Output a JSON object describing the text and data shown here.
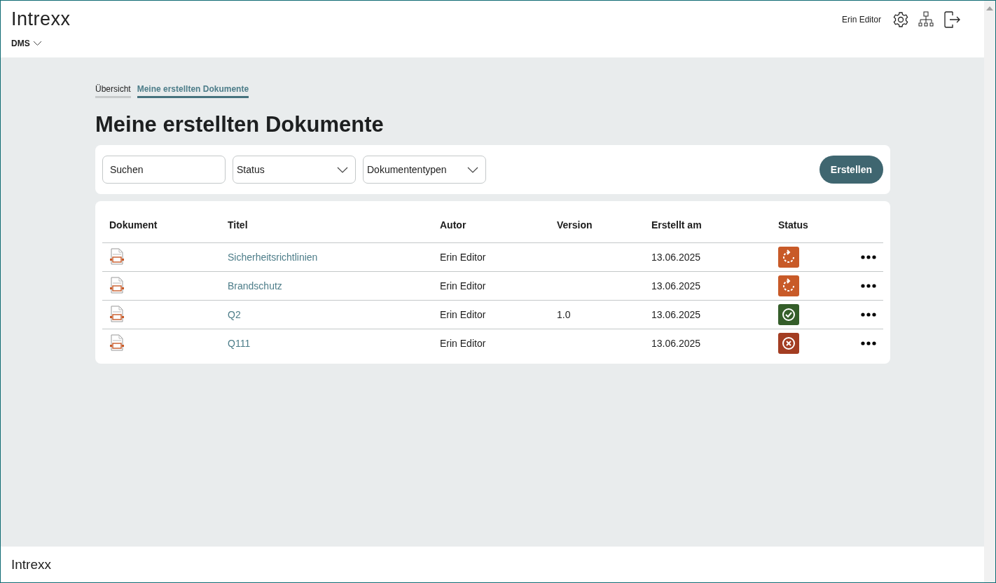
{
  "header": {
    "logo": "Intrexx",
    "app_menu": "DMS",
    "user": "Erin Editor"
  },
  "breadcrumbs": [
    {
      "label": "Übersicht",
      "selected": false
    },
    {
      "label": "Meine erstellten Dokumente",
      "selected": true
    }
  ],
  "page_title": "Meine erstellten Dokumente",
  "filters": {
    "search": {
      "placeholder": "Suchen"
    },
    "dropdowns": [
      "Status",
      "Dokumententypen"
    ],
    "create_button": "Erstellen"
  },
  "table": {
    "columns": [
      "Dokument",
      "Titel",
      "Autor",
      "Version",
      "Erstellt am",
      "Status"
    ],
    "rows": [
      {
        "title": "Sicherheitsrichtlinien",
        "author": "Erin Editor",
        "version": "",
        "created": "13.06.2025",
        "status": {
          "kind": "in_progress",
          "color": "#c85a28"
        }
      },
      {
        "title": "Brandschutz",
        "author": "Erin Editor",
        "version": "",
        "created": "13.06.2025",
        "status": {
          "kind": "in_progress",
          "color": "#c85a28"
        }
      },
      {
        "title": "Q2",
        "author": "Erin Editor",
        "version": "1.0",
        "created": "13.06.2025",
        "status": {
          "kind": "approved",
          "color": "#355e2a"
        }
      },
      {
        "title": "Q111",
        "author": "Erin Editor",
        "version": "",
        "created": "13.06.2025",
        "status": {
          "kind": "rejected",
          "color": "#a33d22"
        }
      }
    ]
  },
  "footer": {
    "logo": "Intrexx"
  }
}
